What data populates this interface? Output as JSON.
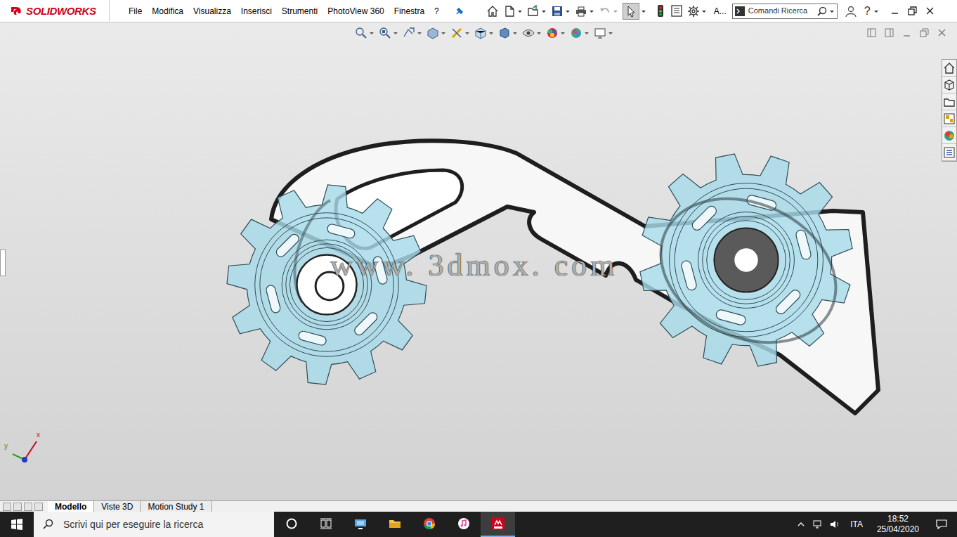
{
  "app": {
    "logo": "SOLIDWORKS"
  },
  "menu": [
    "File",
    "Modifica",
    "Visualizza",
    "Inserisci",
    "Strumenti",
    "PhotoView 360",
    "Finestra",
    "?"
  ],
  "toolbar": {
    "overflow_label": "A...",
    "select_active": true
  },
  "search": {
    "placeholder": "Comandi Ricerca"
  },
  "help": "?",
  "viewport": {
    "watermark": "www. 3dmox. com",
    "triad": {
      "x": "x",
      "y": "y"
    }
  },
  "tabs": [
    {
      "label": "Modello",
      "selected": true
    },
    {
      "label": "Viste 3D",
      "selected": false
    },
    {
      "label": "Motion Study 1",
      "selected": false
    }
  ],
  "taskbar": {
    "search_placeholder": "Scrivi qui per eseguire la ricerca",
    "apps": [
      {
        "kind": "cortana",
        "active": false
      },
      {
        "kind": "taskview",
        "active": false
      },
      {
        "kind": "monitor",
        "active": false
      },
      {
        "kind": "explorer",
        "active": false
      },
      {
        "kind": "chrome",
        "active": false
      },
      {
        "kind": "itunes",
        "active": false
      },
      {
        "kind": "solidworks",
        "active": true
      }
    ],
    "language": "ITA",
    "time": "18:52",
    "date": "25/04/2020"
  }
}
